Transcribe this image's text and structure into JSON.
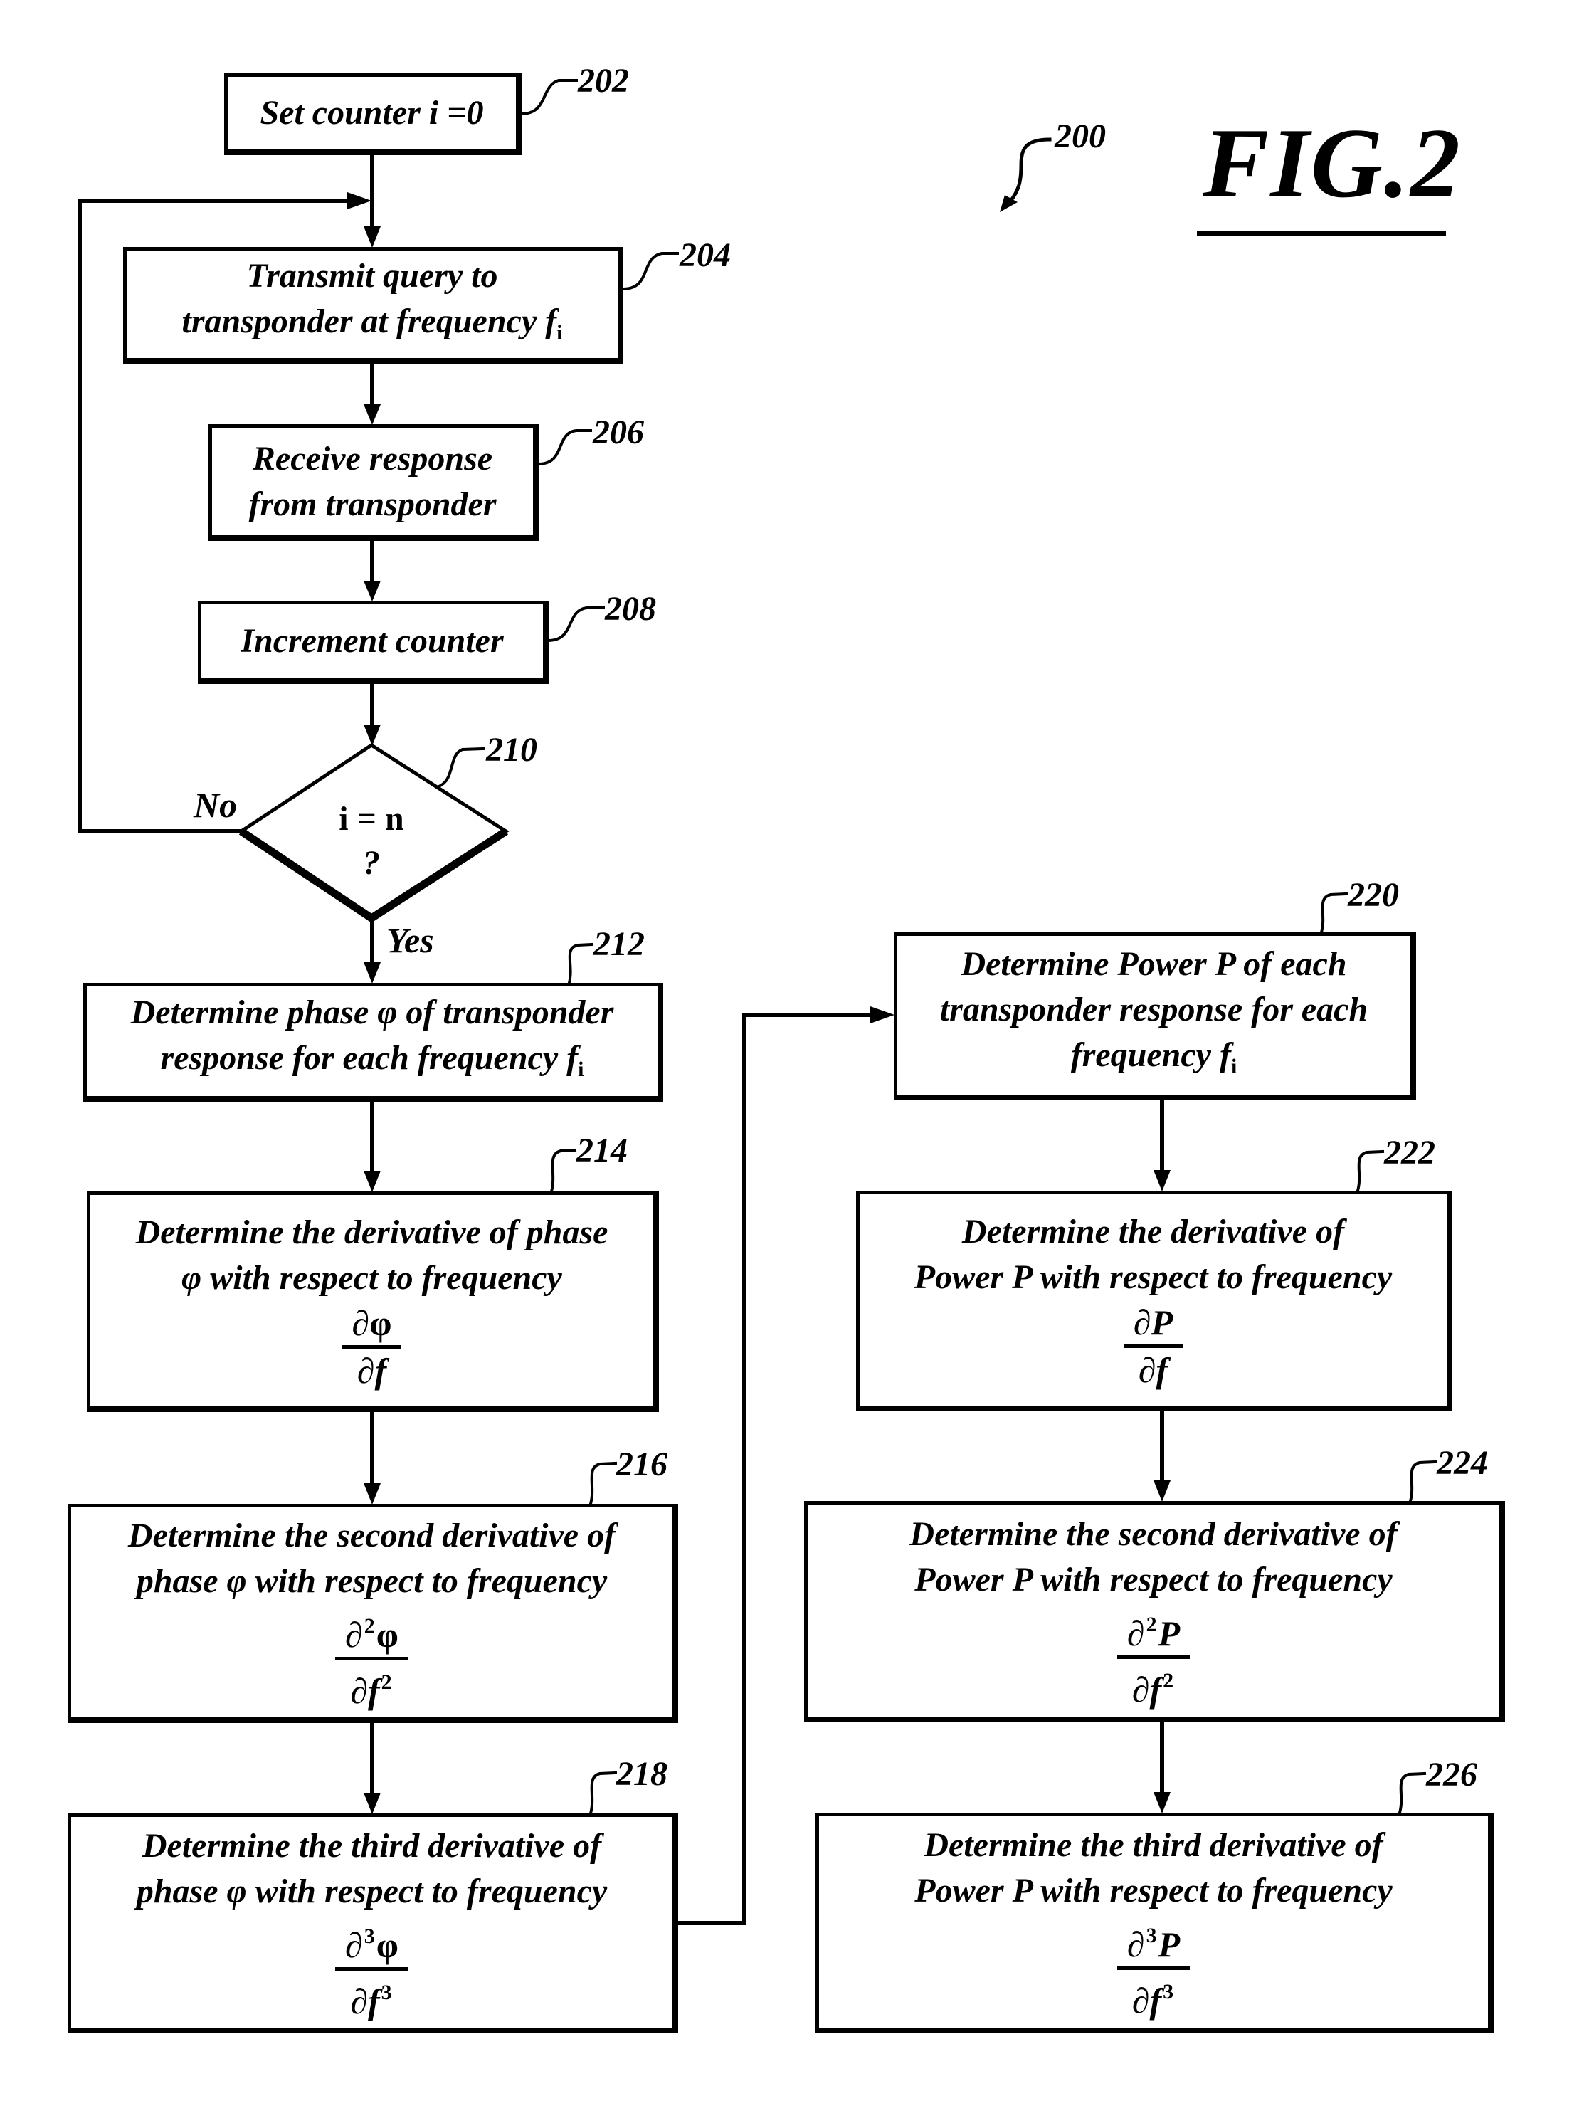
{
  "figure": {
    "title": "FIG.2",
    "reference": "200"
  },
  "steps": {
    "s202": {
      "ref": "202",
      "lines": [
        "Set counter i =0"
      ]
    },
    "s204": {
      "ref": "204",
      "lines": [
        "Transmit query to",
        "transponder at frequency f"
      ],
      "subscript": "i"
    },
    "s206": {
      "ref": "206",
      "lines": [
        "Receive response",
        "from transponder"
      ]
    },
    "s208": {
      "ref": "208",
      "lines": [
        "Increment counter"
      ]
    },
    "s210": {
      "ref": "210",
      "condition": "i = n",
      "question": "?",
      "no_label": "No",
      "yes_label": "Yes"
    },
    "s212": {
      "ref": "212",
      "lines": [
        "Determine phase φ of transponder",
        "response for each frequency f"
      ],
      "subscript": "i"
    },
    "s214": {
      "ref": "214",
      "lines": [
        "Determine the derivative of phase",
        "φ with respect to frequency"
      ],
      "num": "∂φ",
      "den": "∂f",
      "order": ""
    },
    "s216": {
      "ref": "216",
      "lines": [
        "Determine the second derivative of",
        "phase φ with respect to frequency"
      ],
      "num_d": "∂",
      "num_v": "φ",
      "den_d": "∂f",
      "order": "2"
    },
    "s218": {
      "ref": "218",
      "lines": [
        "Determine the third derivative of",
        "phase φ with respect to frequency"
      ],
      "num_d": "∂",
      "num_v": "φ",
      "den_d": "∂f",
      "order": "3"
    },
    "s220": {
      "ref": "220",
      "lines": [
        "Determine Power P of each",
        "transponder response for each",
        "frequency f"
      ],
      "subscript": "i"
    },
    "s222": {
      "ref": "222",
      "lines": [
        "Determine the derivative of",
        "Power P with respect to frequency"
      ],
      "num": "∂P",
      "den": "∂f",
      "order": ""
    },
    "s224": {
      "ref": "224",
      "lines": [
        "Determine the second derivative of",
        "Power P with respect to frequency"
      ],
      "num_d": "∂",
      "num_v": "P",
      "den_d": "∂f",
      "order": "2"
    },
    "s226": {
      "ref": "226",
      "lines": [
        "Determine the third derivative of",
        "Power P with respect to frequency"
      ],
      "num_d": "∂",
      "num_v": "P",
      "den_d": "∂f",
      "order": "3"
    }
  }
}
